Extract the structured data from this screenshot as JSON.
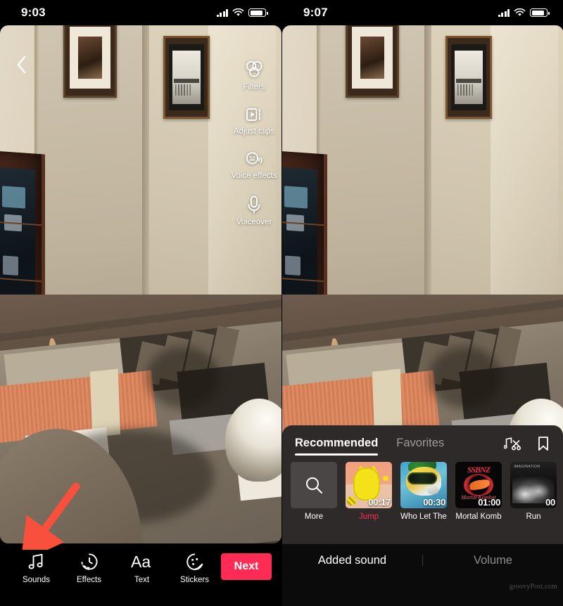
{
  "left_screen": {
    "status": {
      "time": "9:03",
      "signal_icon": "cellular-bars-icon",
      "wifi_icon": "wifi-icon",
      "battery_icon": "battery-icon"
    },
    "back_button": {
      "icon": "chevron-left-icon"
    },
    "tool_rail": [
      {
        "label": "Filters",
        "icon": "filters-icon"
      },
      {
        "label": "Adjust clips",
        "icon": "adjust-clips-icon"
      },
      {
        "label": "Voice effects",
        "icon": "voice-effects-icon"
      },
      {
        "label": "Voiceover",
        "icon": "microphone-icon"
      }
    ],
    "bottom_tools": [
      {
        "label": "Sounds",
        "icon": "music-note-icon"
      },
      {
        "label": "Effects",
        "icon": "effects-clock-icon"
      },
      {
        "label": "Text",
        "icon": "text-aa-icon"
      },
      {
        "label": "Stickers",
        "icon": "sticker-smiley-icon"
      }
    ],
    "next_button": {
      "label": "Next",
      "color": "#fe2c55"
    },
    "annotation": {
      "type": "red-arrow",
      "color": "#f8503c",
      "points_to": "Sounds"
    }
  },
  "right_screen": {
    "status": {
      "time": "9:07",
      "signal_icon": "cellular-bars-icon",
      "wifi_icon": "wifi-icon",
      "battery_icon": "battery-icon"
    },
    "sound_panel": {
      "tabs": [
        {
          "label": "Recommended",
          "active": true
        },
        {
          "label": "Favorites",
          "active": false
        }
      ],
      "actions": [
        {
          "icon": "music-scissors-icon",
          "name": "trim-sound"
        },
        {
          "icon": "bookmark-icon",
          "name": "saved-sounds"
        }
      ],
      "cards": [
        {
          "name": "More",
          "duration": "",
          "art": "search",
          "selected": false,
          "active": false
        },
        {
          "name": "Jump",
          "duration": "00:17",
          "art": "jump",
          "selected": true,
          "active": true
        },
        {
          "name": "Who Let The",
          "duration": "00:30",
          "art": "dog",
          "selected": false,
          "active": false
        },
        {
          "name": "Mortal Komb",
          "duration": "01:00",
          "art": "mortalkombat",
          "selected": false,
          "active": false
        },
        {
          "name": "Run",
          "duration": "00",
          "art": "run",
          "selected": false,
          "active": false
        }
      ]
    },
    "bottom_tabs": [
      {
        "label": "Added sound",
        "active": true
      },
      {
        "label": "Volume",
        "active": false
      }
    ],
    "watermark": "groovyPost.com"
  }
}
